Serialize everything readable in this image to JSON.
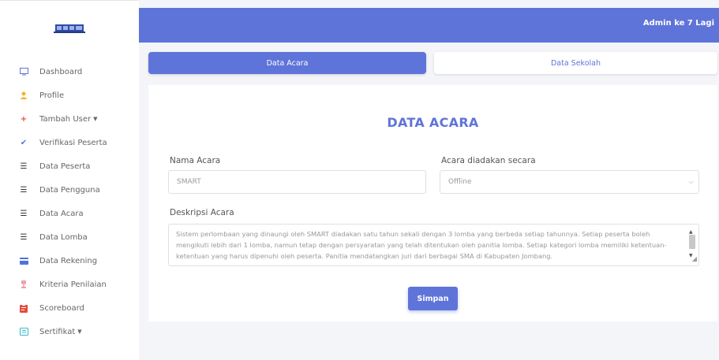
{
  "header": {
    "user": "Admin ke 7 Lagi"
  },
  "sidebar": {
    "items": [
      {
        "label": "Dashboard",
        "icon": "monitor-icon",
        "color": "#5f74d9"
      },
      {
        "label": "Profile",
        "icon": "user-icon",
        "color": "#f3b431"
      },
      {
        "label": "Tambah User",
        "icon": "plus-icon",
        "color": "#e74a3b"
      },
      {
        "label": "Verifikasi Peserta",
        "icon": "check-icon",
        "color": "#5f74d9"
      },
      {
        "label": "Data Peserta",
        "icon": "list-icon",
        "color": "#333333"
      },
      {
        "label": "Data Pengguna",
        "icon": "list-icon",
        "color": "#333333"
      },
      {
        "label": "Data Acara",
        "icon": "list-icon",
        "color": "#333333"
      },
      {
        "label": "Data Lomba",
        "icon": "list-icon",
        "color": "#333333"
      },
      {
        "label": "Data Rekening",
        "icon": "credit-card-icon",
        "color": "#4e73df"
      },
      {
        "label": "Kriteria Penilaian",
        "icon": "trophy-icon",
        "color": "#f0a0b0"
      },
      {
        "label": "Scoreboard",
        "icon": "clipboard-icon",
        "color": "#e74a3b"
      },
      {
        "label": "Sertifikat",
        "icon": "certificate-icon",
        "color": "#36b9cc"
      }
    ]
  },
  "tabs": {
    "active": "Data Acara",
    "inactive": "Data Sekolah"
  },
  "form": {
    "title": "DATA ACARA",
    "nama_label": "Nama Acara",
    "nama_value": "SMART",
    "mode_label": "Acara diadakan secara",
    "mode_value": "Offline",
    "desc_label": "Deskripsi Acara",
    "desc_value": "Sistem perlombaan yang dinaungi oleh SMART diadakan satu tahun sekali dengan 3 lomba yang berbeda setiap tahunnya. Setiap peserta boleh mengikuti lebih dari 1 lomba, namun tetap dengan persyaratan yang telah ditentukan oleh panitia lomba. Setiap kategori lomba memiliki ketentuan-ketentuan yang harus dipenuhi oleh peserta. Panitia mendatangkan juri dari berbagai SMA di Kabupaten Jombang.",
    "submit_label": "Simpan"
  },
  "colors": {
    "accent": "#5f74d9",
    "background": "#f4f5f9"
  }
}
